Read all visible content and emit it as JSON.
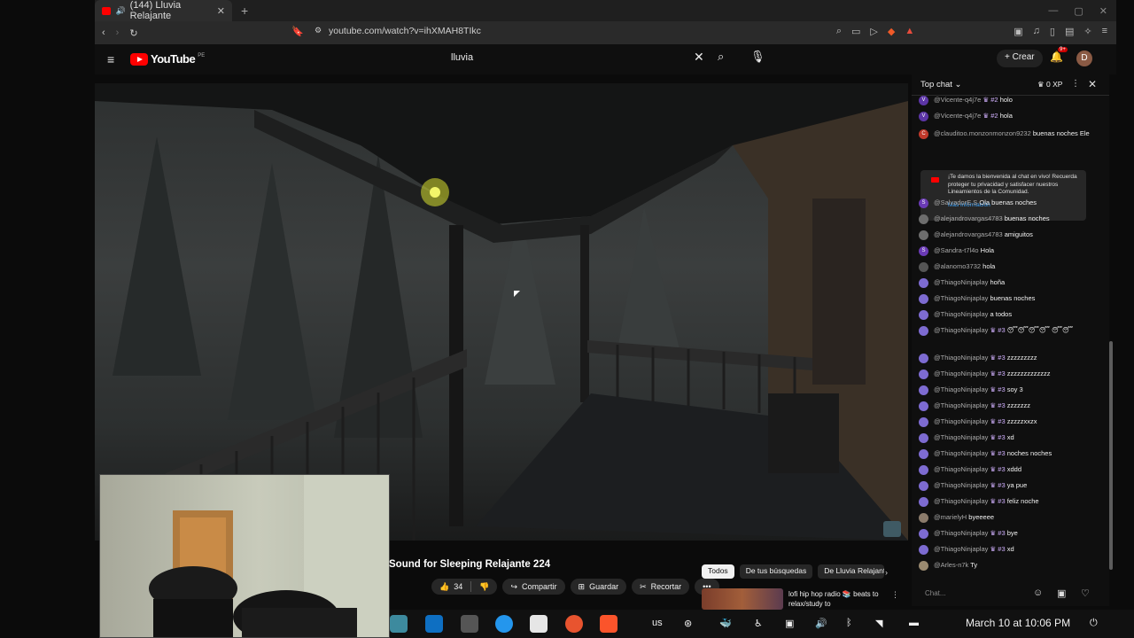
{
  "browser": {
    "tab_title": "(144) Lluvia Relajante",
    "url": "youtube.com/watch?v=ihXMAH8TIkc",
    "notification_badge": "9+"
  },
  "youtube": {
    "logo_text": "YouTube",
    "logo_country": "PE",
    "search_value": "lluvia",
    "create_label": "Crear",
    "avatar_letter": "D"
  },
  "video": {
    "title": "Sound for Sleeping Relajante 224",
    "likes": "34",
    "share_label": "Compartir",
    "save_label": "Guardar",
    "clip_label": "Recortar"
  },
  "chips": [
    "Todos",
    "De tus búsquedas",
    "De Lluvia Relajante"
  ],
  "recommendation": {
    "title": "lofi hip hop radio 📚 beats to relax/study to"
  },
  "chat": {
    "mode": "Top chat",
    "xp": "0 XP",
    "notice_text": "¡Te damos la bienvenida al chat en vivo! Recuerda proteger tu privacidad y satisfacer nuestros Lineamientos de la Comunidad.",
    "notice_link": "Más información",
    "input_placeholder": "Chat...",
    "messages": [
      {
        "author": "@Vicente-q4j7e",
        "badge": "♛ #2",
        "text": "holo",
        "color": "#5c35a6",
        "letter": "V"
      },
      {
        "author": "@Vicente-q4j7e",
        "badge": "♛ #2",
        "text": "hola",
        "color": "#5c35a6",
        "letter": "V"
      },
      {
        "author": "@clauditoo.monzonmonzon9232",
        "badge": "",
        "text": "buenas noches Ele",
        "color": "#c0392b",
        "letter": "C"
      },
      {
        "author": "@SalvadorE.S",
        "badge": "",
        "text": "Ola buenas noches",
        "color": "#6a3ab5",
        "letter": "S"
      },
      {
        "author": "@alejandrovargas4783",
        "badge": "",
        "text": "buenas noches",
        "color": "#6d6d6d",
        "letter": ""
      },
      {
        "author": "@alejandrovargas4783",
        "badge": "",
        "text": "amiguitos",
        "color": "#6d6d6d",
        "letter": ""
      },
      {
        "author": "@Sandra-t7l4o",
        "badge": "",
        "text": "Hola",
        "color": "#6a3ab5",
        "letter": "S"
      },
      {
        "author": "@alanomo3732",
        "badge": "",
        "text": "hola",
        "color": "#555555",
        "letter": ""
      },
      {
        "author": "@ThiagoNinjaplay",
        "badge": "",
        "text": "hoña",
        "color": "#7d6bd1",
        "letter": ""
      },
      {
        "author": "@ThiagoNinjaplay",
        "badge": "",
        "text": "buenas noches",
        "color": "#7d6bd1",
        "letter": ""
      },
      {
        "author": "@ThiagoNinjaplay",
        "badge": "",
        "text": "a todos",
        "color": "#7d6bd1",
        "letter": ""
      },
      {
        "author": "@ThiagoNinjaplay",
        "badge": "♛ #3",
        "text": "😴😴😴😴 😴😴",
        "color": "#7d6bd1",
        "letter": ""
      },
      {
        "author": "@ThiagoNinjaplay",
        "badge": "♛ #3",
        "text": "zzzzzzzzz",
        "color": "#7d6bd1",
        "letter": ""
      },
      {
        "author": "@ThiagoNinjaplay",
        "badge": "♛ #3",
        "text": "zzzzzzzzzzzzz",
        "color": "#7d6bd1",
        "letter": ""
      },
      {
        "author": "@ThiagoNinjaplay",
        "badge": "♛ #3",
        "text": "soy 3",
        "color": "#7d6bd1",
        "letter": ""
      },
      {
        "author": "@ThiagoNinjaplay",
        "badge": "♛ #3",
        "text": "zzzzzzz",
        "color": "#7d6bd1",
        "letter": ""
      },
      {
        "author": "@ThiagoNinjaplay",
        "badge": "♛ #3",
        "text": "zzzzzxxzx",
        "color": "#7d6bd1",
        "letter": ""
      },
      {
        "author": "@ThiagoNinjaplay",
        "badge": "♛ #3",
        "text": "xd",
        "color": "#7d6bd1",
        "letter": ""
      },
      {
        "author": "@ThiagoNinjaplay",
        "badge": "♛ #3",
        "text": "noches noches",
        "color": "#7d6bd1",
        "letter": ""
      },
      {
        "author": "@ThiagoNinjaplay",
        "badge": "♛ #3",
        "text": "xddd",
        "color": "#7d6bd1",
        "letter": ""
      },
      {
        "author": "@ThiagoNinjaplay",
        "badge": "♛ #3",
        "text": "ya pue",
        "color": "#7d6bd1",
        "letter": ""
      },
      {
        "author": "@ThiagoNinjaplay",
        "badge": "♛ #3",
        "text": "feliz noche",
        "color": "#7d6bd1",
        "letter": ""
      },
      {
        "author": "@marielyH",
        "badge": "",
        "text": "byeeeee",
        "color": "#8b7b6b",
        "letter": ""
      },
      {
        "author": "@ThiagoNinjaplay",
        "badge": "♛ #3",
        "text": "bye",
        "color": "#7d6bd1",
        "letter": ""
      },
      {
        "author": "@ThiagoNinjaplay",
        "badge": "♛ #3",
        "text": "xd",
        "color": "#7d6bd1",
        "letter": ""
      },
      {
        "author": "@Arles-n7k",
        "badge": "",
        "text": "Ty",
        "color": "#9a8a70",
        "letter": ""
      }
    ]
  },
  "taskbar": {
    "keyboard_layout": "us",
    "datetime": "March 10 at 10:06 PM"
  }
}
